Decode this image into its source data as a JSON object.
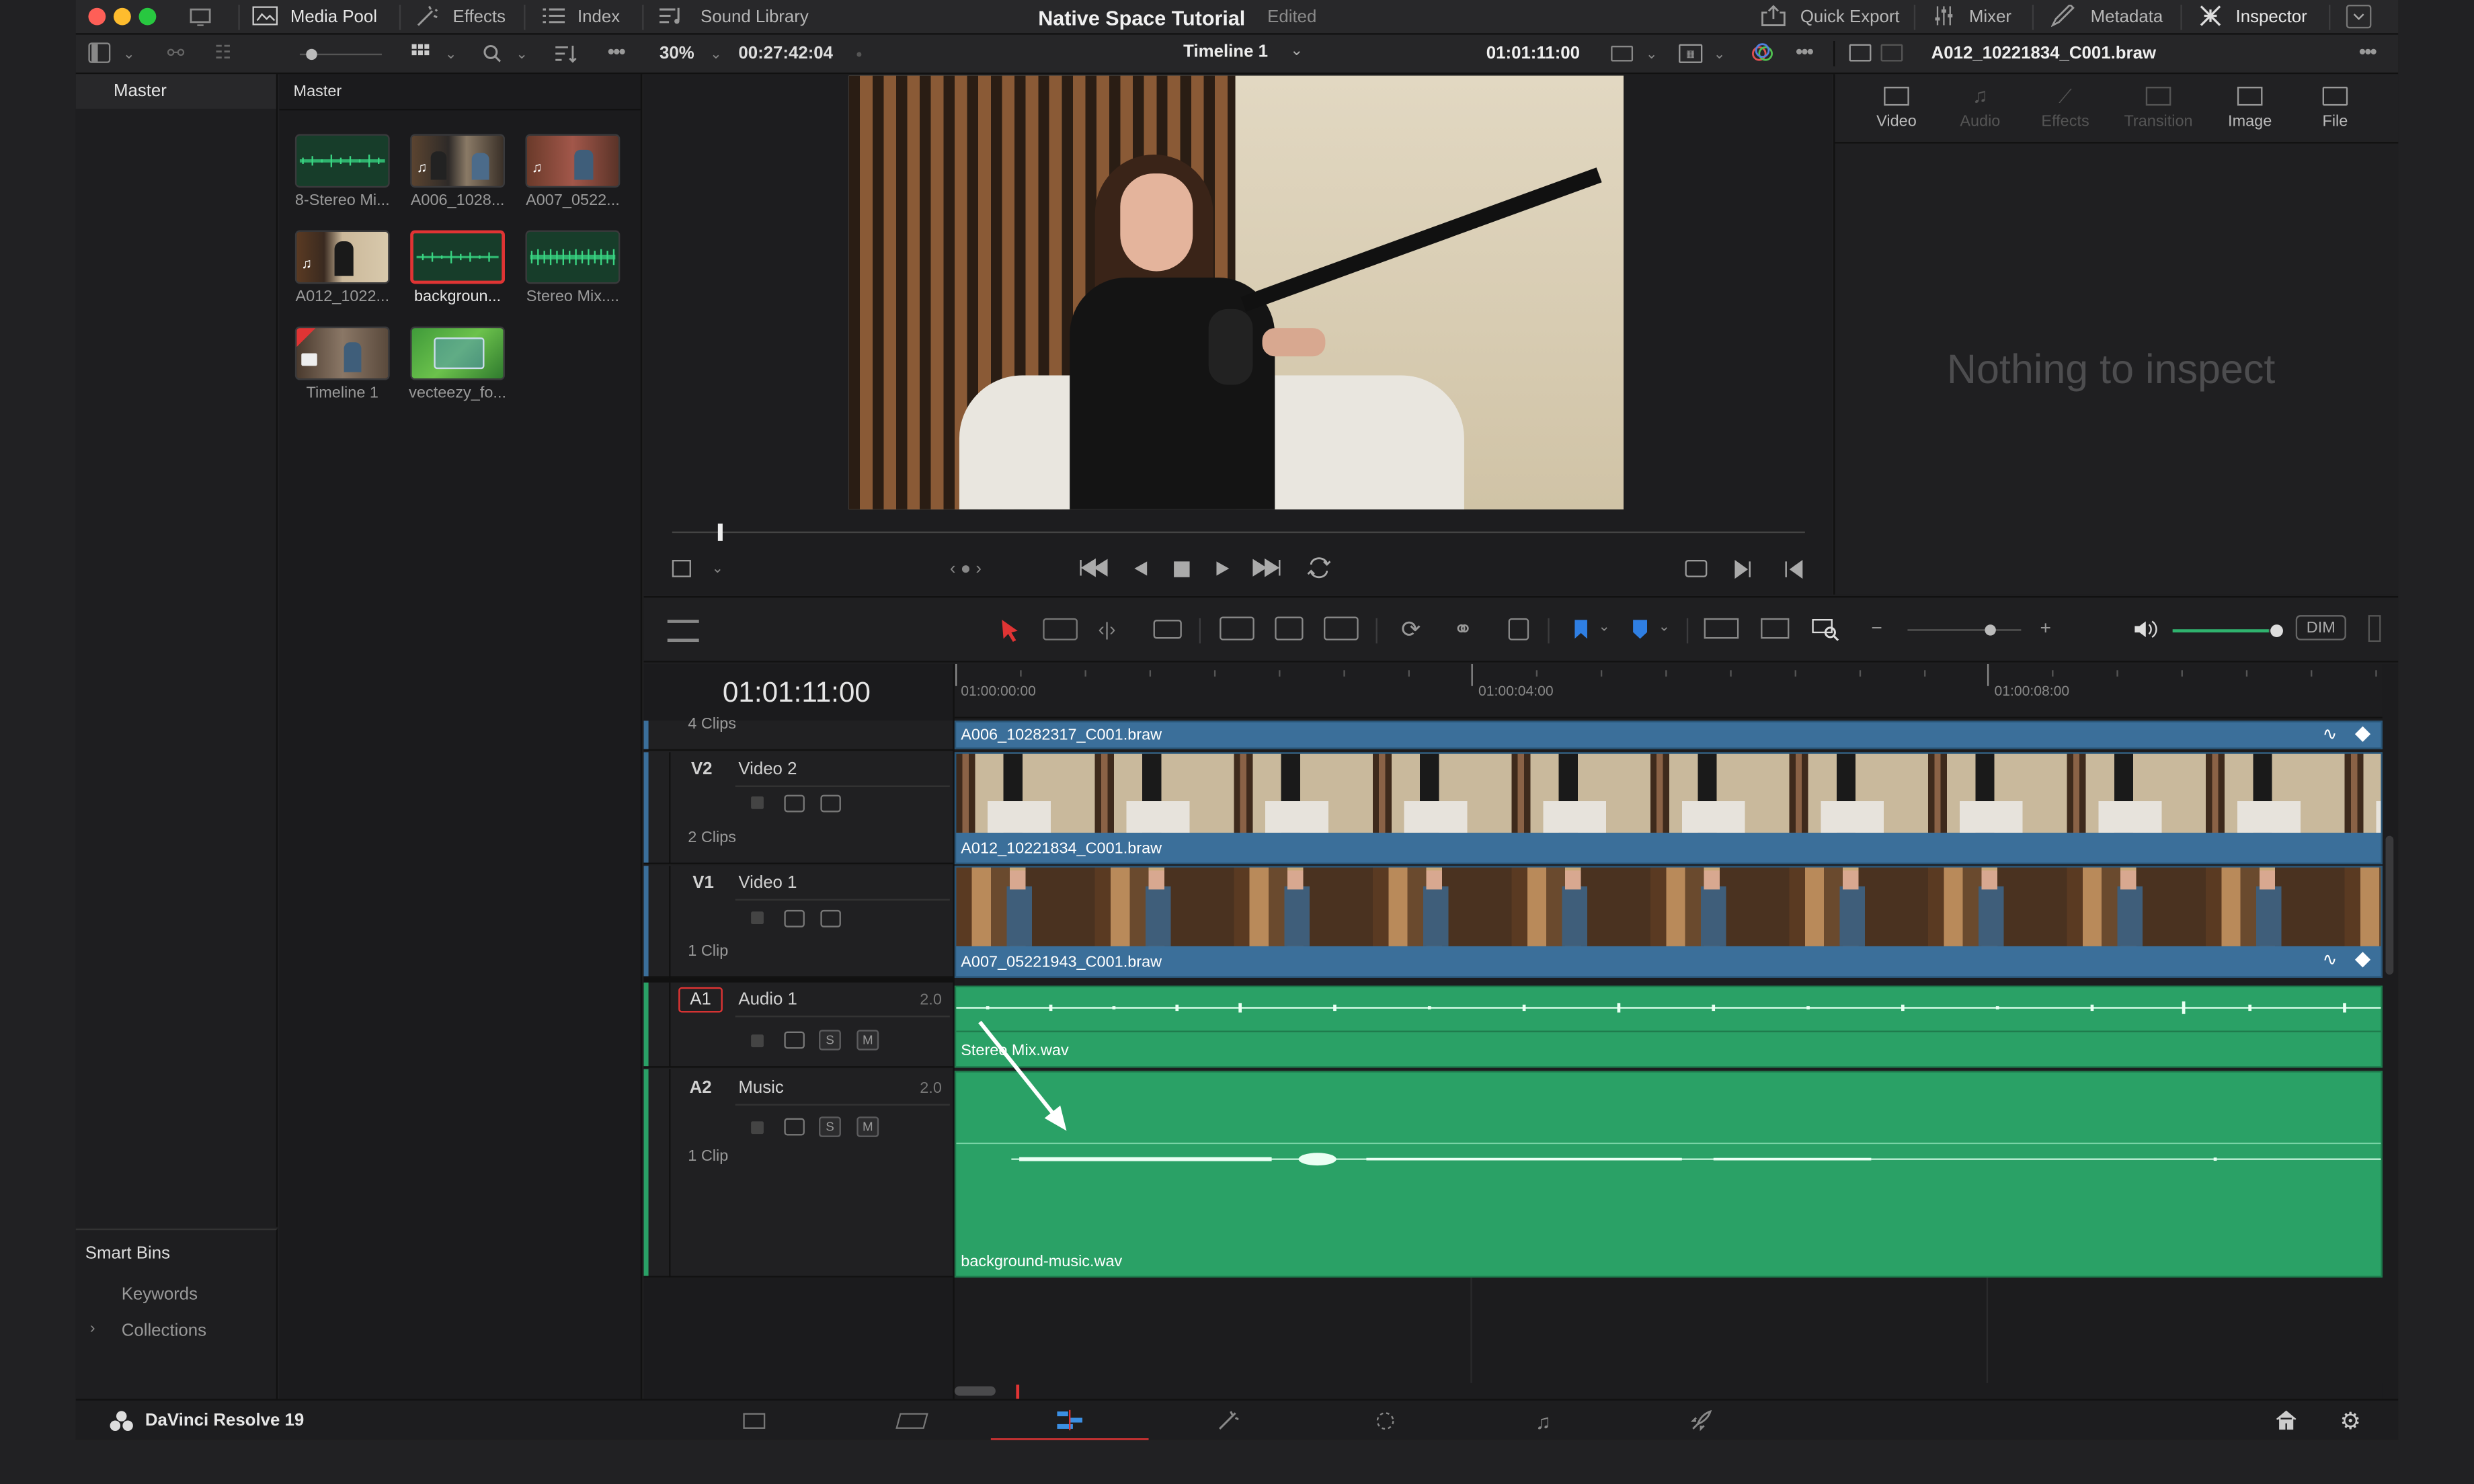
{
  "app": {
    "project_title": "Native Space Tutorial",
    "project_status": "Edited",
    "brand_name": "DaVinci Resolve 19",
    "accent_red": "#e03434",
    "accent_blue": "#3b6f9a",
    "accent_green": "#2aa166"
  },
  "header": {
    "left_tabs": [
      {
        "label": "Media Pool",
        "icon": "media-pool-icon"
      },
      {
        "label": "Effects",
        "icon": "effects-icon"
      },
      {
        "label": "Index",
        "icon": "index-icon"
      },
      {
        "label": "Sound Library",
        "icon": "sound-library-icon"
      }
    ],
    "right_tabs": [
      {
        "label": "Quick Export",
        "icon": "export-icon"
      },
      {
        "label": "Mixer",
        "icon": "mixer-icon"
      },
      {
        "label": "Metadata",
        "icon": "metadata-icon"
      },
      {
        "label": "Inspector",
        "icon": "inspector-icon"
      }
    ]
  },
  "toolbar": {
    "zoom": "30%",
    "timecode_duration": "00:27:42:04",
    "timeline_name": "Timeline 1",
    "timecode_current": "01:01:11:00",
    "clip_name": "A012_10221834_C001.braw"
  },
  "sidebar": {
    "master_label": "Master",
    "smart_bins_label": "Smart Bins",
    "items": [
      "Keywords",
      "Collections"
    ]
  },
  "media_pool": {
    "header": "Master",
    "clips": [
      {
        "label": "8-Stereo Mi...",
        "kind": "audio",
        "selected": false
      },
      {
        "label": "A006_1028...",
        "kind": "video",
        "selected": false
      },
      {
        "label": "A007_0522...",
        "kind": "video",
        "selected": false
      },
      {
        "label": "A012_1022...",
        "kind": "video",
        "selected": false
      },
      {
        "label": "backgroun...",
        "kind": "audio",
        "selected": true
      },
      {
        "label": "Stereo Mix....",
        "kind": "audio",
        "selected": false
      },
      {
        "label": "Timeline 1",
        "kind": "timeline",
        "selected": false
      },
      {
        "label": "vecteezy_fo...",
        "kind": "graphic",
        "selected": false
      }
    ]
  },
  "inspector": {
    "tabs": [
      "Video",
      "Audio",
      "Effects",
      "Transition",
      "Image",
      "File"
    ],
    "empty_message": "Nothing to inspect"
  },
  "timeline": {
    "timecode": "01:01:11:00",
    "ruler_labels": [
      "01:00:00:00",
      "01:00:04:00",
      "01:00:08:00"
    ],
    "dim_label": "DIM",
    "volume": 0.9,
    "tracks": {
      "v3": {
        "clip_count": "4 Clips",
        "clip_name": "A006_10282317_C001.braw"
      },
      "v2": {
        "id": "V2",
        "name": "Video 2",
        "clip_count": "2 Clips",
        "clip_name": "A012_10221834_C001.braw"
      },
      "v1": {
        "id": "V1",
        "name": "Video 1",
        "clip_count": "1 Clip",
        "clip_name": "A007_05221943_C001.braw"
      },
      "a1": {
        "id": "A1",
        "name": "Audio 1",
        "channels": "2.0",
        "clip_name": "Stereo Mix.wav"
      },
      "a2": {
        "id": "A2",
        "name": "Music",
        "channels": "2.0",
        "clip_count": "1 Clip",
        "clip_name": "background-music.wav"
      }
    },
    "solo_label": "S",
    "mute_label": "M"
  },
  "pages": [
    "media",
    "cut",
    "edit",
    "fusion",
    "color",
    "fairlight",
    "deliver"
  ]
}
